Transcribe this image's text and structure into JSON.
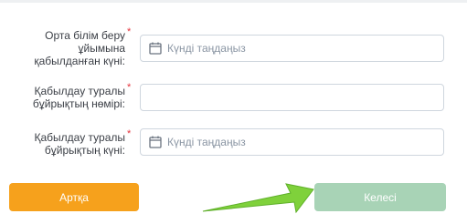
{
  "form": {
    "fields": [
      {
        "label_lines": [
          "Орта білім беру",
          "ұйымына",
          "қабылданған күні:"
        ],
        "required_mark": "*",
        "type": "date",
        "placeholder": "Күнді таңдаңыз"
      },
      {
        "label_lines": [
          "Қабылдау туралы",
          "бұйрықтың нөмірі:"
        ],
        "required_mark": "*",
        "type": "text",
        "placeholder": ""
      },
      {
        "label_lines": [
          "Қабылдау туралы",
          "бұйрықтың күні:"
        ],
        "required_mark": "*",
        "type": "date",
        "placeholder": "Күнді таңдаңыз"
      }
    ]
  },
  "buttons": {
    "back_label": "Артқа",
    "next_label": "Келесі"
  },
  "colors": {
    "back_button": "#f6a11c",
    "next_button": "#a8d3b6",
    "required_mark": "#e5333c",
    "annotation_arrow": "#7fd13b"
  },
  "icons": {
    "date_field_icon": "calendar-icon",
    "annotation": "pointer-arrow-icon"
  }
}
